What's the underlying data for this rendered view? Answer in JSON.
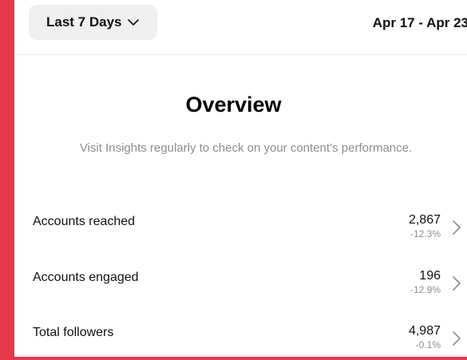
{
  "header": {
    "range_label": "Last 7 Days",
    "range_icon": "chevron-down-icon",
    "date_range": "Apr 17 - Apr 23"
  },
  "overview": {
    "title": "Overview",
    "subtitle": "Visit Insights regularly to check on your content’s performance."
  },
  "metrics": [
    {
      "label": "Accounts reached",
      "value": "2,867",
      "change": "-12.3%",
      "icon": "chevron-right-icon"
    },
    {
      "label": "Accounts engaged",
      "value": "196",
      "change": "-12.9%",
      "icon": "chevron-right-icon"
    },
    {
      "label": "Total followers",
      "value": "4,987",
      "change": "-0.1%",
      "icon": "chevron-right-icon"
    }
  ],
  "colors": {
    "frame": "#e8364a",
    "panel": "#ffffff",
    "button_bg": "#efefef",
    "muted_text": "#8e8e8e"
  }
}
